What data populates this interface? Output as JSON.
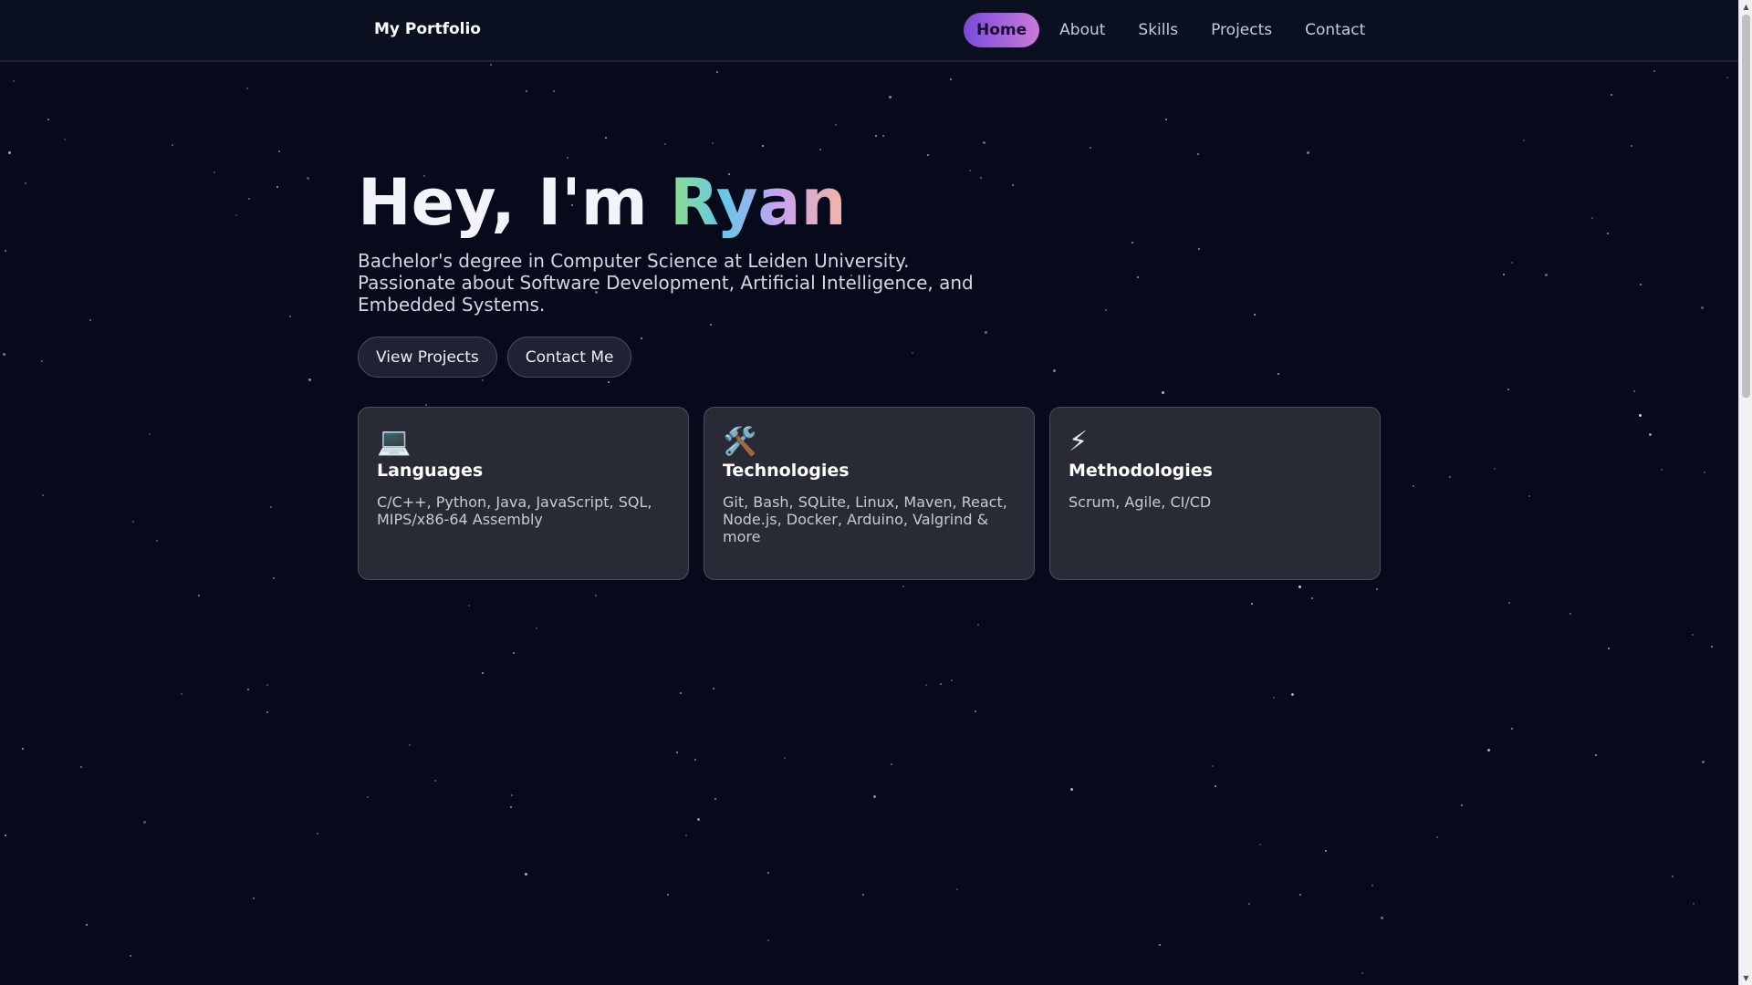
{
  "nav": {
    "brand": "My Portfolio",
    "links": [
      {
        "label": "Home",
        "active": true
      },
      {
        "label": "About",
        "active": false
      },
      {
        "label": "Skills",
        "active": false
      },
      {
        "label": "Projects",
        "active": false
      },
      {
        "label": "Contact",
        "active": false
      }
    ]
  },
  "hero": {
    "greeting": "Hey, I'm ",
    "name": "Ryan",
    "description": "Bachelor's degree in Computer Science at Leiden University. Passionate about Software Development, Artificial Intelligence, and Embedded Systems.",
    "buttons": {
      "view_projects": "View Projects",
      "contact_me": "Contact Me"
    }
  },
  "cards": [
    {
      "icon": "💻",
      "icon_name": "laptop-icon",
      "title": "Languages",
      "text": "C/C++, Python, Java, JavaScript, SQL, MIPS/x86-64 Assembly"
    },
    {
      "icon": "🛠️",
      "icon_name": "tools-icon",
      "title": "Technologies",
      "text": "Git, Bash, SQLite, Linux, Maven, React, Node.js, Docker, Arduino, Valgrind & more"
    },
    {
      "icon": "⚡",
      "icon_name": "lightning-icon",
      "title": "Methodologies",
      "text": "Scrum, Agile, CI/CD"
    }
  ],
  "colors": {
    "background": "#060a1a",
    "card": "#282a36",
    "active_nav_gradient": [
      "#7a4bd9",
      "#c97bd8"
    ]
  }
}
